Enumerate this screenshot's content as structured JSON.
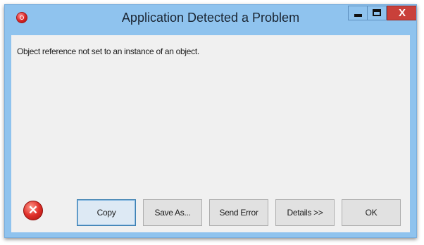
{
  "window": {
    "title": "Application Detected a Problem",
    "app_icon": "error-badge-icon",
    "controls": {
      "minimize_icon": "minimize-icon",
      "maximize_icon": "maximize-icon",
      "close_label": "X"
    }
  },
  "dialog": {
    "message": "Object reference not set to an instance of an object.",
    "icon": "error-circle-icon",
    "icon_glyph": "✕"
  },
  "buttons": {
    "copy": "Copy",
    "save_as": "Save As...",
    "send_error": "Send Error",
    "details": "Details >>",
    "ok": "OK"
  },
  "colors": {
    "title_bar": "#8fc3ee",
    "close_button": "#c9403a",
    "client_area": "#f0f0f0",
    "default_button_border": "#3c7fb1"
  }
}
